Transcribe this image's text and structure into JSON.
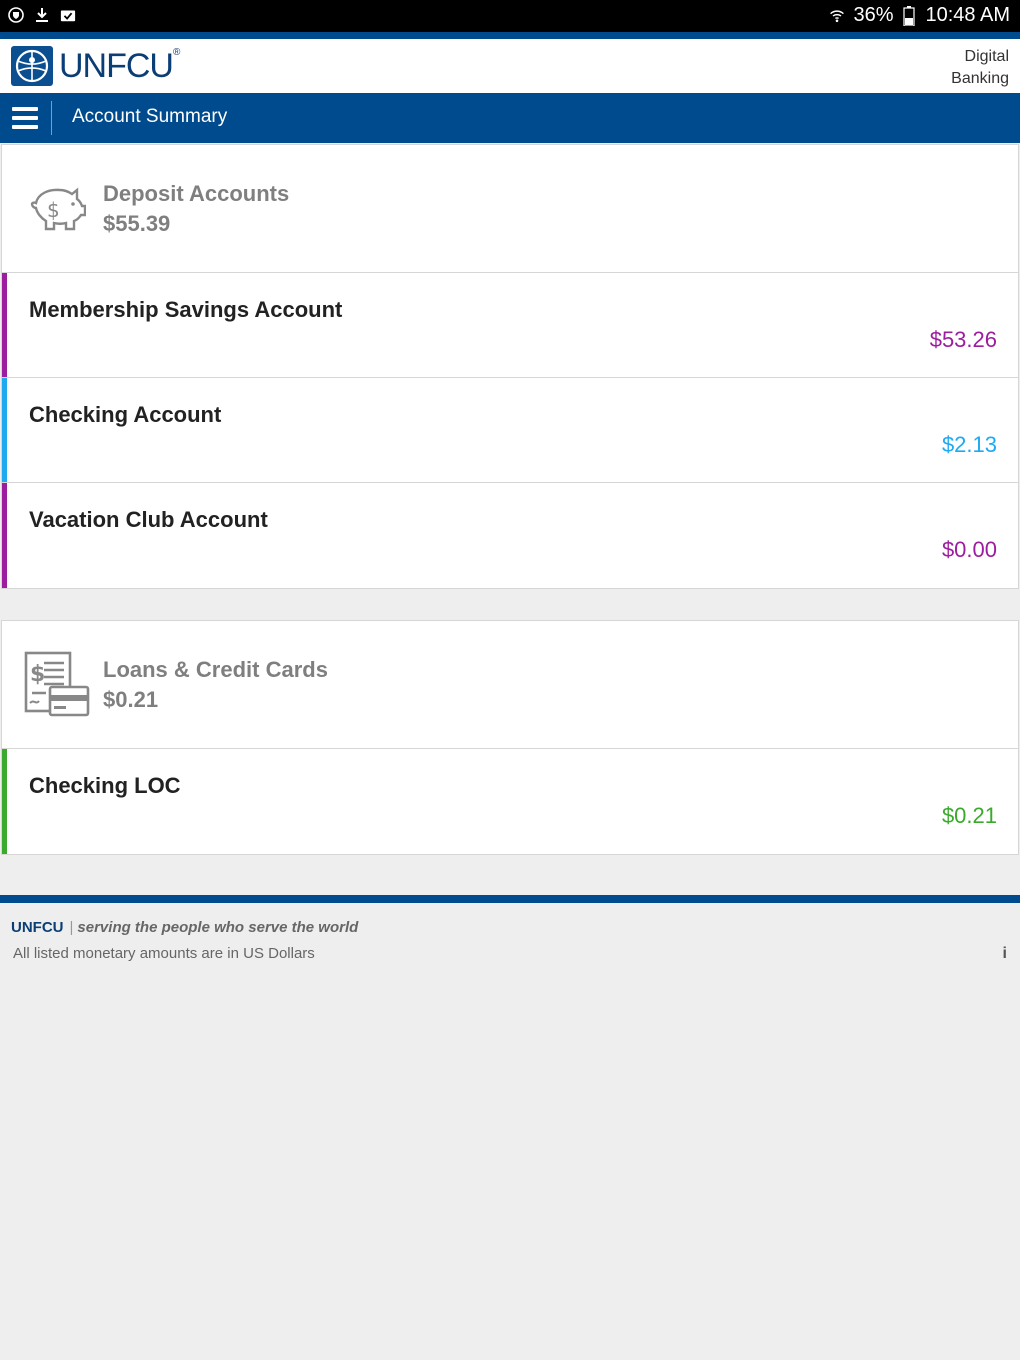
{
  "status_bar": {
    "battery": "36%",
    "time": "10:48 AM"
  },
  "header": {
    "brand": "UNFCU",
    "brand_mark": "®",
    "right_line1": "Digital",
    "right_line2": "Banking"
  },
  "nav": {
    "title": "Account Summary"
  },
  "deposits": {
    "name": "Deposit Accounts",
    "total": "$55.39",
    "accounts": [
      {
        "name": "Membership Savings Account",
        "amount": "$53.26",
        "color": "#9c1d9e"
      },
      {
        "name": "Checking Account",
        "amount": "$2.13",
        "color": "#1eaaf1"
      },
      {
        "name": "Vacation Club Account",
        "amount": "$0.00",
        "color": "#9c1d9e"
      }
    ]
  },
  "loans": {
    "name": "Loans & Credit Cards",
    "total": "$0.21",
    "accounts": [
      {
        "name": "Checking LOC",
        "amount": "$0.21",
        "color": "#3aaa2c"
      }
    ]
  },
  "footer": {
    "brand": "UNFCU",
    "tagline": "serving the people who serve the world",
    "note": "All listed monetary amounts are in US Dollars",
    "info": "i"
  },
  "colors": {
    "primary": "#004b8d",
    "brand_dark": "#0b3e75"
  }
}
